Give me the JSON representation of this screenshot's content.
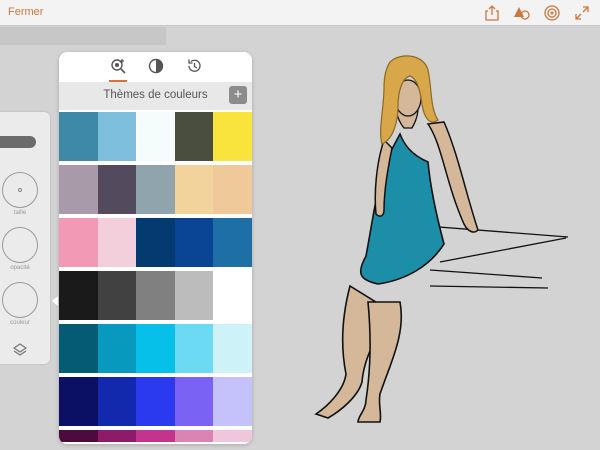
{
  "topbar": {
    "close_label": "Fermer",
    "icons": [
      "share-icon",
      "shapes-icon",
      "target-icon",
      "fullscreen-icon"
    ],
    "accent_color": "#d1753e"
  },
  "tool_rail": {
    "size_label": "taille",
    "opacity_label": "opacité",
    "color_label": "couleur",
    "layers_icon": "layers-icon"
  },
  "panel": {
    "tabs": [
      {
        "name": "color-themes-tab",
        "icon": "color-search-icon",
        "active": true
      },
      {
        "name": "color-wheel-tab",
        "icon": "color-wheel-icon",
        "active": false
      },
      {
        "name": "recent-colors-tab",
        "icon": "history-icon",
        "active": false
      }
    ],
    "title": "Thèmes de couleurs",
    "add_label": "+",
    "themes": [
      [
        "#3f89a8",
        "#7ebfdd",
        "#f4fcfc",
        "#4a4e3e",
        "#f8e43c"
      ],
      [
        "#a89aa8",
        "#544a5e",
        "#8fa4ac",
        "#f2d39c",
        "#efc99a"
      ],
      [
        "#f29ab5",
        "#f3cfdc",
        "#033a70",
        "#0a4595",
        "#1d6fa5"
      ],
      [
        "#1a1a1a",
        "#414141",
        "#808080",
        "#bcbcbc",
        "#ffffff"
      ],
      [
        "#045b73",
        "#0799be",
        "#07c0e9",
        "#6ddaf4",
        "#cdf2f8"
      ],
      [
        "#0b1064",
        "#1229ad",
        "#2b39ef",
        "#7a63f4",
        "#c5c1fb"
      ],
      [
        "#4d0a3c",
        "#8e1b6a",
        "#c2348e",
        "#d984b2",
        "#efc6dc"
      ]
    ]
  },
  "drawing": {
    "dress_color": "#1d8ea8",
    "skin_color": "#d5b89a",
    "hair_color": "#d7a74a"
  }
}
